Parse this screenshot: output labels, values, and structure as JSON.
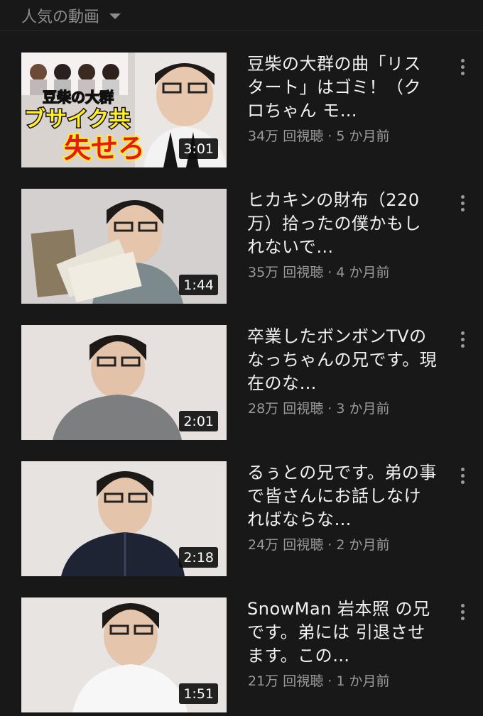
{
  "sort": {
    "label": "人気の動画",
    "icon": "caret-down-icon"
  },
  "videos": [
    {
      "title": "豆柴の大群の曲「リスタート」はゴミ！（クロちゃん モ…",
      "views": "34万 回視聴",
      "age": "5 か月前",
      "duration": "3:01",
      "overlay": {
        "top": "豆柴の大群",
        "mid": "ブサイク共",
        "bottom": "失せろ"
      }
    },
    {
      "title": "ヒカキンの財布（220万）拾ったの僕かもしれないで…",
      "views": "35万 回視聴",
      "age": "4 か月前",
      "duration": "1:44"
    },
    {
      "title": "卒業したボンボンTVのなっちゃんの兄です。現在のな…",
      "views": "28万 回視聴",
      "age": "3 か月前",
      "duration": "2:01"
    },
    {
      "title": "るぅとの兄です。弟の事で皆さんにお話しなければならな…",
      "views": "24万 回視聴",
      "age": "2 か月前",
      "duration": "2:18"
    },
    {
      "title": "SnowMan 岩本照 の兄です。弟には 引退させます。この…",
      "views": "21万 回視聴",
      "age": "1 か月前",
      "duration": "1:51"
    }
  ],
  "separator": "·"
}
